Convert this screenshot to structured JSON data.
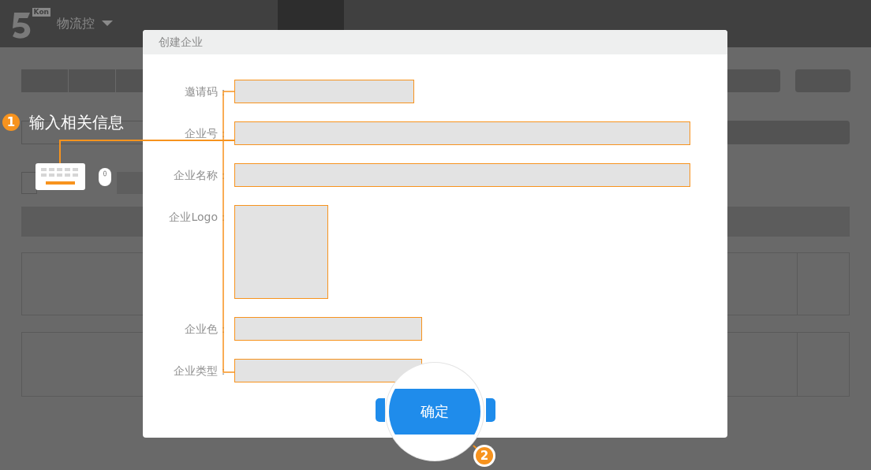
{
  "app": {
    "logo_badge": "Kon",
    "title": "物流控"
  },
  "dialog": {
    "title": "创建企业",
    "fields": [
      {
        "label": "邀请码：",
        "kind": "short"
      },
      {
        "label": "企业号：",
        "kind": "long"
      },
      {
        "label": "企业名称：",
        "kind": "long"
      },
      {
        "label": "企业Logo：",
        "kind": "image"
      },
      {
        "label": "企业色：",
        "kind": "medium"
      },
      {
        "label": "企业类型：",
        "kind": "medium"
      }
    ],
    "confirm_button": "确定"
  },
  "annotations": [
    {
      "number": "1",
      "text": "输入相关信息"
    },
    {
      "number": "2"
    }
  ]
}
